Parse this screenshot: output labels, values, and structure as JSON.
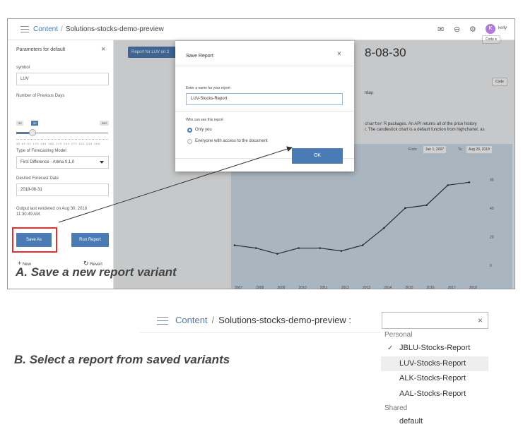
{
  "panel_a": {
    "breadcrumb": {
      "root": "Content",
      "separator": "/",
      "current": "Solutions-stocks-demo-preview"
    },
    "topbar_icons": [
      "mail-icon",
      "minus-circle-icon",
      "gear-icon"
    ],
    "user": {
      "initial": "K",
      "name": "kelly"
    },
    "sidebar": {
      "title": "Parameters for default",
      "close": "×",
      "symbol_label": "symbol",
      "symbol_value": "LUV",
      "days_label": "Number of Previous Days",
      "days_min": "30",
      "days_value": "90",
      "days_max": "360",
      "days_ticks": "30 60 90 120 150 180 210 240 270 300 330 360",
      "slider_fraction": 0.18,
      "model_label": "Type of Forecasting Model",
      "model_value": "First Difference - Arima 0,1,0",
      "date_label": "Desired Forecast Date",
      "date_value": "2018-08-31",
      "output_note_1": "Output last rendered on Aug 30, 2018",
      "output_note_2": "11:30:49 AM.",
      "save_as_label": "Save As",
      "run_label": "Run Report",
      "new_label": "New",
      "revert_label": "Revert"
    },
    "main": {
      "report_button": "Report for LUV on 2",
      "code_top": "Code ▾",
      "code_side": "Code",
      "date_heading": "8-08-30",
      "text_rday": "rday.",
      "text_line1_code": "charter",
      "text_line1": "R packages. An API returns all of the price history",
      "text_line2": "r. The candlestick chart is a default function from highcharter, as",
      "range_from_label": "From",
      "range_from": "Jan 1, 2007",
      "range_to_label": "To",
      "range_to": "Aug 29, 2018"
    },
    "dialog": {
      "title": "Save Report",
      "close": "×",
      "name_label": "Enter a name for your report",
      "name_value": "LUV-Stocks-Report",
      "access_label": "Who can see this report",
      "option_only_you": "Only you",
      "option_everyone": "Everyone with access to the document",
      "ok_label": "OK"
    },
    "caption": "A. Save a new report variant"
  },
  "panel_b": {
    "breadcrumb": {
      "root": "Content",
      "separator": "/",
      "current": "Solutions-stocks-demo-preview :"
    },
    "select_clear": "×",
    "group_personal": "Personal",
    "personal_items": [
      "JBLU-Stocks-Report",
      "LUV-Stocks-Report",
      "ALK-Stocks-Report",
      "AAL-Stocks-Report"
    ],
    "checked_item": "JBLU-Stocks-Report",
    "highlighted_item": "LUV-Stocks-Report",
    "group_shared": "Shared",
    "shared_items": [
      "default"
    ],
    "caption": "B. Select a report from saved variants"
  },
  "chart_data": {
    "type": "line",
    "title": "",
    "xlabel": "",
    "ylabel": "",
    "x": [
      2007,
      2008,
      2009,
      2010,
      2011,
      2012,
      2013,
      2014,
      2015,
      2016,
      2017,
      2018
    ],
    "xtick_labels": [
      "2007",
      "2008",
      "2009",
      "2010",
      "2011",
      "2012",
      "2013",
      "2014",
      "2015",
      "2016",
      "2017",
      "2018"
    ],
    "series": [
      {
        "values": [
          14,
          12,
          8,
          12,
          12,
          10,
          14,
          26,
          40,
          42,
          56,
          58
        ]
      }
    ],
    "yticks": [
      0,
      20,
      40,
      60
    ],
    "ylim": [
      -5,
      70
    ]
  },
  "colors": {
    "accent": "#4b7bb4",
    "highlight_box": "#e03030",
    "chart_bg": "#cfdde9"
  }
}
